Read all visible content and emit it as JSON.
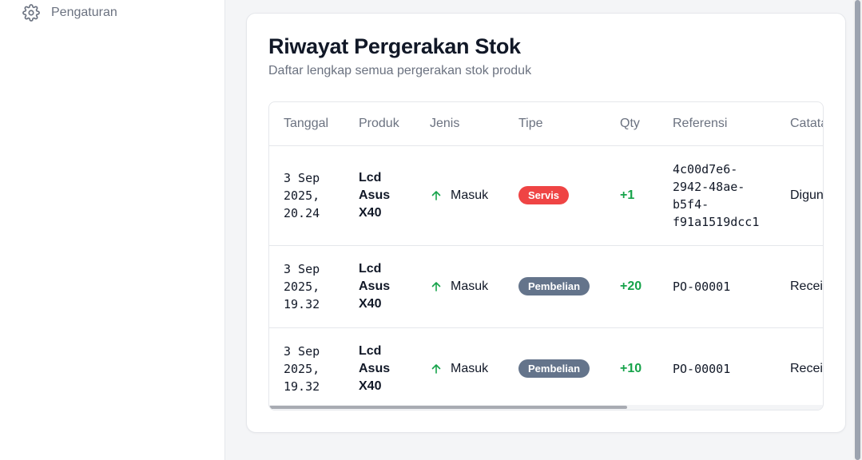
{
  "sidebar": {
    "items": [
      {
        "label": "Pengaturan",
        "icon": "gear-icon"
      }
    ]
  },
  "card": {
    "title": "Riwayat Pergerakan Stok",
    "subtitle": "Daftar lengkap semua pergerakan stok produk"
  },
  "table": {
    "headers": [
      "Tanggal",
      "Produk",
      "Jenis",
      "Tipe",
      "Qty",
      "Referensi",
      "Catatan"
    ],
    "rows": [
      {
        "date": [
          "3 Sep",
          "2025,",
          "20.24"
        ],
        "product": [
          "Lcd",
          "Asus",
          "X40"
        ],
        "jenis": "Masuk",
        "tipe": "Servis",
        "qty": "+1",
        "ref": [
          "4c00d7e6-",
          "2942-48ae-",
          "b5f4-",
          "f91a1519dcc1"
        ],
        "note": "Digunakan"
      },
      {
        "date": [
          "3 Sep",
          "2025,",
          "19.32"
        ],
        "product": [
          "Lcd",
          "Asus",
          "X40"
        ],
        "jenis": "Masuk",
        "tipe": "Pembelian",
        "qty": "+20",
        "ref": [
          "PO-00001"
        ],
        "note": "Receive"
      },
      {
        "date": [
          "3 Sep",
          "2025,",
          "19.32"
        ],
        "product": [
          "Lcd",
          "Asus",
          "X40"
        ],
        "jenis": "Masuk",
        "tipe": "Pembelian",
        "qty": "+10",
        "ref": [
          "PO-00001"
        ],
        "note": "Receive"
      }
    ]
  },
  "colors": {
    "servis": "#ef4444",
    "pembelian": "#64748b",
    "qty_positive": "#16a34a",
    "arrow_up": "#16a34a"
  }
}
